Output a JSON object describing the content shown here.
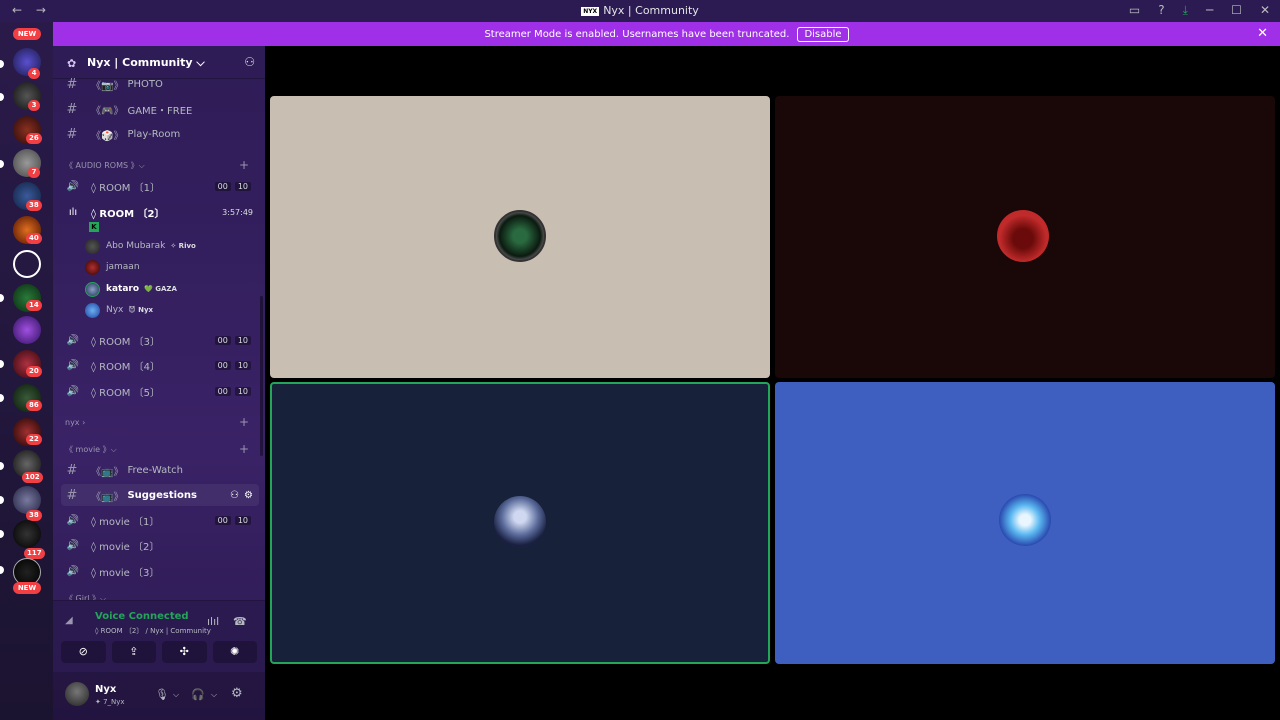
{
  "window": {
    "title": "Nyx | Community",
    "logo_text": "NYX",
    "back_glyph": "←",
    "forward_glyph": "→",
    "controls": [
      "inbox-icon",
      "help-icon",
      "download-icon",
      "minimize-icon",
      "maximize-icon",
      "close-icon"
    ],
    "control_glyphs": [
      "▭",
      "?",
      "⤓",
      "─",
      "☐",
      "✕"
    ]
  },
  "banner": {
    "text": "Streamer Mode is enabled. Usernames have been truncated.",
    "button": "Disable",
    "close_glyph": "✕",
    "color": "#a030e8"
  },
  "rail": {
    "new_label": "NEW",
    "badges": [
      "4",
      "3",
      "26",
      "7",
      "38",
      "40",
      "14",
      "20",
      "86",
      "22",
      "102",
      "38",
      "117"
    ]
  },
  "guild": {
    "name": "Nyx | Community",
    "chevron": "⌵"
  },
  "channels_top": [
    {
      "type": "text",
      "emoji": "《📷》",
      "name": "PHOTO"
    },
    {
      "type": "text",
      "emoji": "《🎮》",
      "name": "GAME・FREE"
    },
    {
      "type": "text",
      "emoji": "《🎲》",
      "name": "Play-Room"
    }
  ],
  "categories": {
    "audio": "《 AUDIO ROMS 》⌵",
    "nyx": "nyx ›",
    "movie": "《 movie 》⌵",
    "girl": "《 Girl 》⌵"
  },
  "voice_rooms": [
    {
      "name": "◊ ROOM 〔1〕",
      "c1": "00",
      "c2": "10"
    },
    {
      "name": "◊ ROOM 〔2〕",
      "timer": "3:57:49"
    },
    {
      "name": "◊ ROOM 〔3〕",
      "c1": "00",
      "c2": "10"
    },
    {
      "name": "◊ ROOM 〔4〕",
      "c1": "00",
      "c2": "10"
    },
    {
      "name": "◊ ROOM 〔5〕",
      "c1": "00",
      "c2": "10"
    }
  ],
  "room2_members": [
    {
      "name": "Abo Mubarak",
      "tag": "✧ Rivo"
    },
    {
      "name": "jamaan",
      "tag": ""
    },
    {
      "name": "kataro",
      "tag": "💚 GAZA"
    },
    {
      "name": "Nyx",
      "tag": "😈 Nyx"
    }
  ],
  "movie_channels": [
    {
      "type": "text",
      "emoji": "《📺》",
      "name": "Free-Watch"
    },
    {
      "type": "text",
      "emoji": "《📺》",
      "name": "Suggestions"
    },
    {
      "type": "voice",
      "name": "◊ movie 〔1〕",
      "c1": "00",
      "c2": "10"
    },
    {
      "type": "voice",
      "name": "◊ movie 〔2〕"
    },
    {
      "type": "voice",
      "name": "◊ movie 〔3〕"
    }
  ],
  "voice": {
    "status": "Voice Connected",
    "channel": "◊ ROOM 〔2〕 / Nyx | Community",
    "actions": [
      "camera-off-icon",
      "screen-share-icon",
      "activities-icon",
      "soundboard-icon"
    ],
    "action_glyphs": [
      "⊘",
      "⇪",
      "✣",
      "✺"
    ]
  },
  "user": {
    "name": "Nyx",
    "status": "✦ 7_Nyx"
  },
  "tiles": [
    {
      "user": "Abo Mubarak",
      "bg": "#c8beb2"
    },
    {
      "user": "jamaan",
      "bg": "#1a0708"
    },
    {
      "user": "kataro",
      "bg": "#18213a",
      "speaking": true
    },
    {
      "user": "Nyx",
      "bg": "#3f5fc0"
    }
  ]
}
